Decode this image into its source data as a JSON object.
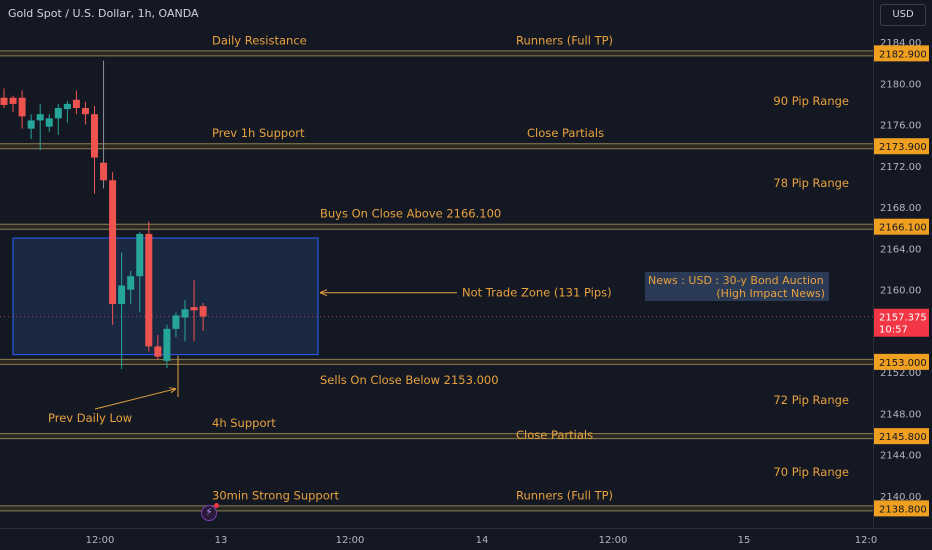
{
  "header": {
    "symbol_title": "Gold Spot / U.S. Dollar, 1h, OANDA",
    "currency_button": "USD"
  },
  "news_box": {
    "line1": "News : USD : 30-y Bond Auction",
    "line2": "(High Impact News)"
  },
  "colors": {
    "background": "#141823",
    "up_candle": "#26a69a",
    "down_candle": "#ef5350",
    "level_line": "#8a7c56",
    "annotation_text": "#e8a13e",
    "zone_fill": "#1c2b46",
    "zone_border": "#2962ff",
    "price_tag": "#f0a020",
    "last_price_tag": "#f23645"
  },
  "icons": [
    "lightning-icon"
  ],
  "chart_data": {
    "type": "candlestick",
    "title": "Gold Spot / U.S. Dollar, 1h, OANDA",
    "ylim": [
      2136.5,
      2186.5
    ],
    "y_ticks": [
      2140.0,
      2144.0,
      2148.0,
      2152.0,
      2156.0,
      2160.0,
      2164.0,
      2168.0,
      2172.0,
      2176.0,
      2180.0,
      2184.0
    ],
    "x_ticks": [
      "12:00",
      "13",
      "12:00",
      "14",
      "12:00",
      "15",
      "12:0"
    ],
    "grid": false,
    "candles": [
      {
        "open": 2178.6,
        "high": 2179.5,
        "low": 2177.6,
        "close": 2177.9
      },
      {
        "open": 2178.6,
        "high": 2178.8,
        "low": 2177.2,
        "close": 2178.0
      },
      {
        "open": 2178.6,
        "high": 2179.3,
        "low": 2175.6,
        "close": 2176.8
      },
      {
        "open": 2175.6,
        "high": 2177.0,
        "low": 2174.6,
        "close": 2176.4
      },
      {
        "open": 2176.4,
        "high": 2178.0,
        "low": 2173.5,
        "close": 2177.0
      },
      {
        "open": 2175.8,
        "high": 2177.0,
        "low": 2175.3,
        "close": 2176.6
      },
      {
        "open": 2176.6,
        "high": 2178.0,
        "low": 2175.0,
        "close": 2177.6
      },
      {
        "open": 2177.5,
        "high": 2178.3,
        "low": 2176.2,
        "close": 2178.0
      },
      {
        "open": 2178.4,
        "high": 2179.3,
        "low": 2177.0,
        "close": 2177.6
      },
      {
        "open": 2177.6,
        "high": 2178.2,
        "low": 2176.0,
        "close": 2177.0
      },
      {
        "open": 2177.0,
        "high": 2177.8,
        "low": 2169.3,
        "close": 2172.8
      },
      {
        "open": 2172.3,
        "high": 2182.2,
        "low": 2169.8,
        "close": 2170.6
      },
      {
        "open": 2170.6,
        "high": 2171.4,
        "low": 2156.6,
        "close": 2158.6
      },
      {
        "open": 2158.6,
        "high": 2163.6,
        "low": 2152.3,
        "close": 2160.4
      },
      {
        "open": 2160.0,
        "high": 2161.8,
        "low": 2158.6,
        "close": 2161.3
      },
      {
        "open": 2161.3,
        "high": 2165.6,
        "low": 2157.8,
        "close": 2165.4
      },
      {
        "open": 2165.4,
        "high": 2166.6,
        "low": 2154.0,
        "close": 2154.5
      },
      {
        "open": 2154.5,
        "high": 2155.6,
        "low": 2153.2,
        "close": 2153.5
      },
      {
        "open": 2153.1,
        "high": 2156.6,
        "low": 2152.4,
        "close": 2156.2
      },
      {
        "open": 2156.2,
        "high": 2157.8,
        "low": 2155.4,
        "close": 2157.5
      },
      {
        "open": 2157.3,
        "high": 2159.0,
        "low": 2155.0,
        "close": 2158.1
      },
      {
        "open": 2158.3,
        "high": 2160.9,
        "low": 2155.0,
        "close": 2158.0
      },
      {
        "open": 2158.4,
        "high": 2158.7,
        "low": 2156.0,
        "close": 2157.4
      }
    ],
    "levels": [
      {
        "price": 2182.9,
        "tag": "2182.900",
        "label_left": "Daily Resistance",
        "label_right": "Runners (Full TP)"
      },
      {
        "price": 2173.9,
        "tag": "2173.900",
        "label_left": "Prev 1h Support",
        "label_right": "Close Partials"
      },
      {
        "price": 2166.1,
        "tag": "2166.100",
        "label_left": "",
        "label_right": "Buys On Close Above 2166.100"
      },
      {
        "price": 2153.0,
        "tag": "2153.000",
        "label_left": "",
        "label_right": "Sells On Close Below 2153.000"
      },
      {
        "price": 2145.8,
        "tag": "2145.800",
        "label_left": "4h Support",
        "label_right": "Close Partials"
      },
      {
        "price": 2138.8,
        "tag": "2138.800",
        "label_left": "30min Strong Support",
        "label_right": "Runners (Full TP)"
      }
    ],
    "range_labels": [
      "90 Pip Range",
      "78 Pip Range",
      "72 Pip Range",
      "70 Pip Range"
    ],
    "zone": {
      "top": 2165.0,
      "bottom": 2153.7,
      "label": "Not Trade Zone (131 Pips)"
    },
    "prev_daily_low_label": "Prev Daily Low",
    "last_price": {
      "value": 2157.375,
      "tag": "2157.375",
      "countdown": "10:57"
    }
  }
}
